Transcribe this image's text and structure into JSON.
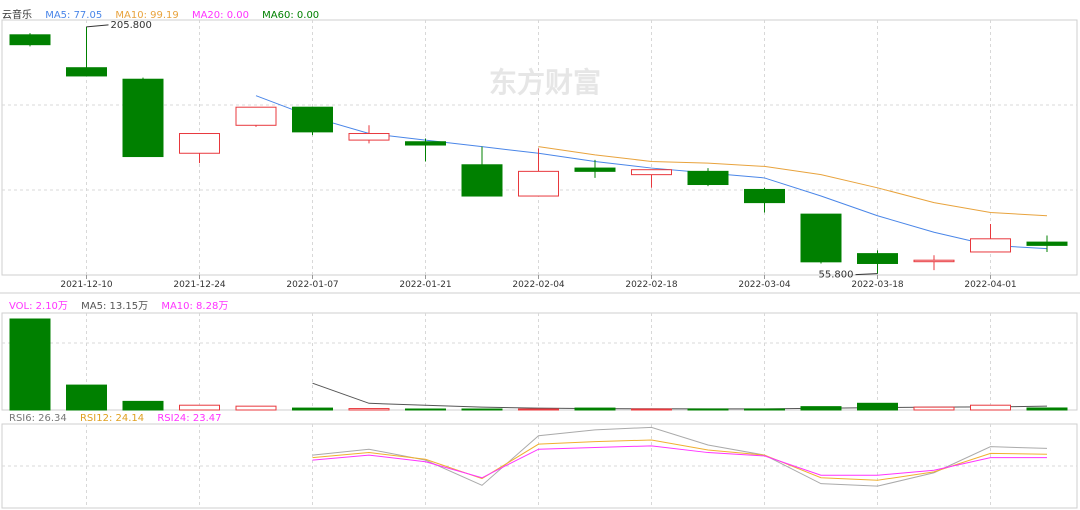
{
  "legend": {
    "name": "云音乐",
    "ma5": "MA5: 77.05",
    "ma10": "MA10: 99.19",
    "ma20": "MA20: 0.00",
    "ma60": "MA60: 0.00"
  },
  "vol_legend": {
    "vol": "VOL: 2.10万",
    "ma5": "MA5: 13.15万",
    "ma10": "MA10: 8.28万"
  },
  "rsi_legend": {
    "rsi6": "RSI6: 26.34",
    "rsi12": "RSI12: 24.14",
    "rsi24": "RSI24: 23.47"
  },
  "watermark": "东方财富",
  "colors": {
    "up": "#e8383d",
    "down": "#008000",
    "ma5": "#4a86e8",
    "ma10": "#e8a33d",
    "ma20": "#ff33ff",
    "ma60": "#008000",
    "vol_ma5": "#555555",
    "rsi6": "#aaaaaa",
    "rsi12": "#f0b030",
    "rsi24": "#ff33ff",
    "grid": "#d8d8d8"
  },
  "chart_data": {
    "type": "candlestick",
    "price_range": [
      55,
      210
    ],
    "x_tick_labels": [
      "2021-12-10",
      "2021-12-24",
      "2022-01-07",
      "2022-01-21",
      "2022-02-04",
      "2022-02-18",
      "2022-03-04",
      "2022-03-18",
      "2022-04-01"
    ],
    "annotations": {
      "high": "205.800",
      "low": "55.800"
    },
    "candles": [
      {
        "o": 201,
        "h": 202,
        "l": 194,
        "c": 195
      },
      {
        "o": 181,
        "h": 205.8,
        "l": 177,
        "c": 176
      },
      {
        "o": 174,
        "h": 175,
        "l": 127,
        "c": 127
      },
      {
        "o": 129,
        "h": 138,
        "l": 123,
        "c": 141
      },
      {
        "o": 146,
        "h": 156,
        "l": 145,
        "c": 157
      },
      {
        "o": 157,
        "h": 157,
        "l": 140,
        "c": 142
      },
      {
        "o": 137,
        "h": 146,
        "l": 135,
        "c": 141
      },
      {
        "o": 136,
        "h": 138,
        "l": 124,
        "c": 134
      },
      {
        "o": 122,
        "h": 133,
        "l": 103,
        "c": 103
      },
      {
        "o": 103,
        "h": 132,
        "l": 103,
        "c": 118
      },
      {
        "o": 120,
        "h": 125,
        "l": 114,
        "c": 118
      },
      {
        "o": 116,
        "h": 119,
        "l": 108,
        "c": 119
      },
      {
        "o": 118,
        "h": 120,
        "l": 109,
        "c": 110
      },
      {
        "o": 107,
        "h": 108,
        "l": 93,
        "c": 99
      },
      {
        "o": 92,
        "h": 92,
        "l": 62,
        "c": 63
      },
      {
        "o": 68,
        "h": 70,
        "l": 55.8,
        "c": 62
      },
      {
        "o": 64,
        "h": 67,
        "l": 58,
        "c": 64
      },
      {
        "o": 69,
        "h": 86,
        "l": 69,
        "c": 77
      },
      {
        "o": 75,
        "h": 79,
        "l": 69,
        "c": 73
      }
    ],
    "ma5": [
      null,
      null,
      null,
      null,
      164,
      151,
      141,
      137,
      133,
      129,
      124,
      120,
      117,
      114,
      103,
      91,
      81,
      73,
      71
    ],
    "ma10": [
      null,
      null,
      null,
      null,
      null,
      null,
      null,
      null,
      null,
      133,
      128,
      124,
      123,
      121,
      116,
      108,
      99,
      93,
      91
    ],
    "volume": {
      "max": 95,
      "values": [
        95,
        26,
        9,
        5,
        4,
        2,
        1.5,
        1,
        0.5,
        1,
        2,
        1,
        1,
        1,
        3.5,
        7,
        3,
        5,
        2.1
      ],
      "ma5": [
        null,
        null,
        null,
        null,
        null,
        28,
        7,
        5,
        3,
        2,
        1.5,
        1.3,
        1.2,
        1.2,
        1.8,
        2.5,
        3,
        3.2,
        4
      ],
      "ma10": [
        null,
        null,
        null,
        null,
        null,
        null,
        null,
        null,
        null,
        null,
        null,
        null,
        null,
        null,
        null,
        null,
        null,
        null,
        null
      ]
    },
    "rsi": {
      "range": [
        0,
        100
      ],
      "rsi6": [
        null,
        null,
        null,
        null,
        null,
        63,
        70,
        57,
        27,
        86,
        93,
        96,
        75,
        63,
        29,
        26,
        42,
        73,
        71
      ],
      "rsi12": [
        null,
        null,
        null,
        null,
        null,
        60,
        66,
        58,
        35,
        76,
        79,
        81,
        69,
        63,
        36,
        33,
        43,
        65,
        64
      ],
      "rsi24": [
        null,
        null,
        null,
        null,
        null,
        57,
        63,
        55,
        36,
        70,
        72,
        74,
        66,
        62,
        39,
        39,
        45,
        60,
        60
      ]
    }
  }
}
